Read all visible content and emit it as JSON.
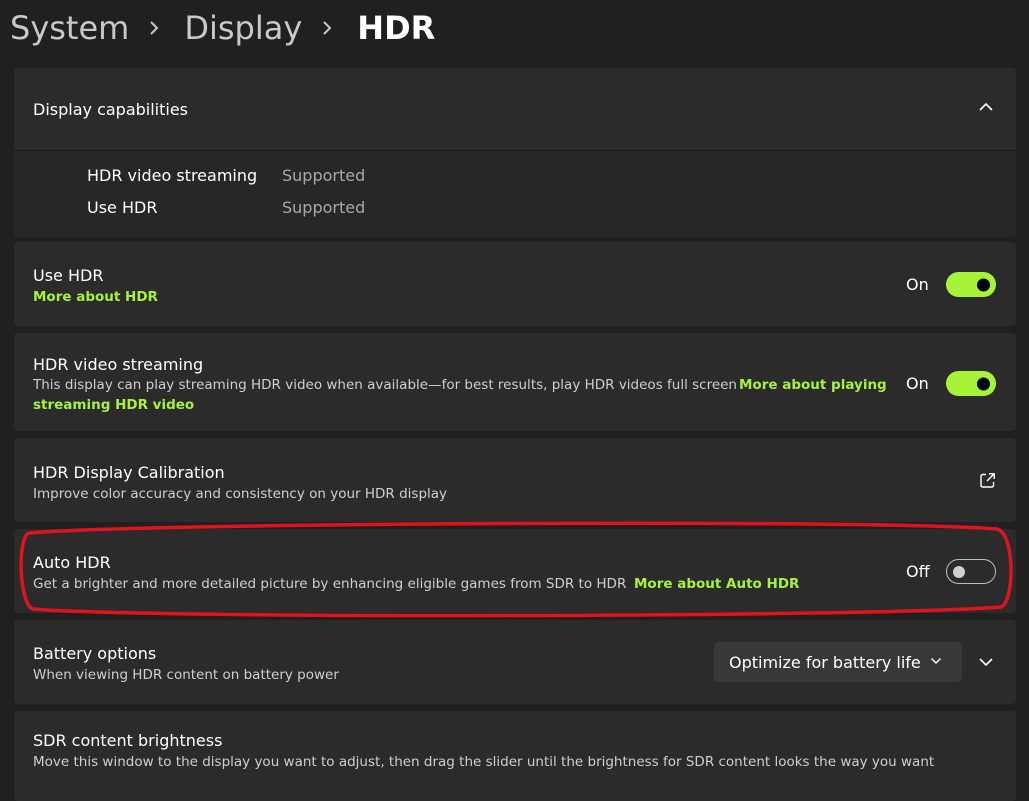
{
  "breadcrumb": {
    "items": [
      "System",
      "Display",
      "HDR"
    ]
  },
  "capabilities": {
    "title": "Display capabilities",
    "rows": [
      {
        "label": "HDR video streaming",
        "value": "Supported"
      },
      {
        "label": "Use HDR",
        "value": "Supported"
      }
    ]
  },
  "use_hdr": {
    "title": "Use HDR",
    "link": "More about HDR",
    "state": "On"
  },
  "video_streaming": {
    "title": "HDR video streaming",
    "description": "This display can play streaming HDR video when available—for best results, play HDR videos full screen",
    "link_line1": "More about playing",
    "link_line2": "streaming HDR video",
    "state": "On"
  },
  "calibration": {
    "title": "HDR Display Calibration",
    "description": "Improve color accuracy and consistency on your HDR display"
  },
  "auto_hdr": {
    "title": "Auto HDR",
    "description": "Get a brighter and more detailed picture by enhancing eligible games from SDR to HDR",
    "link": "More about Auto HDR",
    "state": "Off"
  },
  "battery": {
    "title": "Battery options",
    "description": "When viewing HDR content on battery power",
    "selected_option": "Optimize for battery life"
  },
  "sdr_brightness": {
    "title": "SDR content brightness",
    "description": "Move this window to the display you want to adjust, then drag the slider until the brightness for SDR content looks the way you want"
  },
  "colors": {
    "accent": "#a7f33a",
    "highlight": "#e0141e",
    "card": "#2b2b2b",
    "background": "#202020"
  },
  "icons": [
    "chevron-right-icon",
    "chevron-up-icon",
    "external-link-icon",
    "chevron-down-icon"
  ]
}
